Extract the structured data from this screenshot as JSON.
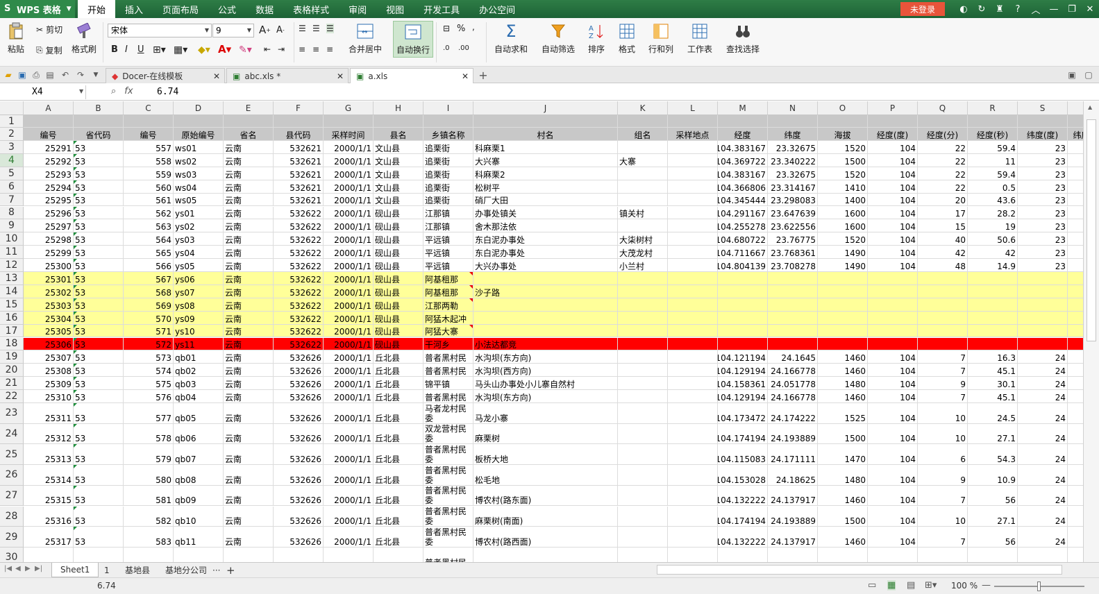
{
  "app": {
    "name": "WPS 表格",
    "login_label": "未登录",
    "help_label": "?"
  },
  "menu_tabs": [
    "开始",
    "插入",
    "页面布局",
    "公式",
    "数据",
    "表格样式",
    "审阅",
    "视图",
    "开发工具",
    "办公空间"
  ],
  "ribbon": {
    "paste": "粘贴",
    "cut": "剪切",
    "copy": "复制",
    "format_painter": "格式刷",
    "font_name": "宋体",
    "font_size": "9",
    "bold": "B",
    "italic": "I",
    "underline": "U",
    "merge_center": "合并居中",
    "wrap_text": "自动换行",
    "percent": "%",
    "autosum": "自动求和",
    "autofilter": "自动筛选",
    "sort": "排序",
    "format": "格式",
    "row_col": "行和列",
    "worksheet": "工作表",
    "find_select": "查找选择"
  },
  "doc_tabs": [
    {
      "label": "Docer-在线模板"
    },
    {
      "label": "abc.xls *"
    },
    {
      "label": "a.xls"
    }
  ],
  "formula_bar": {
    "cell_ref": "X4",
    "fx": "fx",
    "value": "6.74"
  },
  "columns": [
    "A",
    "B",
    "C",
    "D",
    "E",
    "F",
    "G",
    "H",
    "I",
    "J",
    "K",
    "L",
    "M",
    "N",
    "O",
    "P",
    "Q",
    "R",
    "S"
  ],
  "header_row": [
    "编号",
    "省代码",
    "编号",
    "原始编号",
    "省名",
    "县代码",
    "采样时间",
    "县名",
    "乡镇名称",
    "村名",
    "组名",
    "采样地点",
    "经度",
    "纬度",
    "海拔",
    "经度(度)",
    "经度(分)",
    "经度(秒)",
    "纬度(度)",
    "纬度"
  ],
  "rows": [
    {
      "n": "3",
      "cells": [
        "25291",
        "53",
        "557",
        "ws01",
        "云南",
        "532621",
        "2000/1/1",
        "文山县",
        "追栗街",
        "科麻栗1",
        "",
        "",
        "104.383167",
        "23.32675",
        "1520",
        "104",
        "22",
        "59.4",
        "23"
      ]
    },
    {
      "n": "4",
      "cells": [
        "25292",
        "53",
        "558",
        "ws02",
        "云南",
        "532621",
        "2000/1/1",
        "文山县",
        "追栗街",
        "大兴寨",
        "大寨",
        "",
        "104.369722",
        "23.340222",
        "1500",
        "104",
        "22",
        "11",
        "23"
      ]
    },
    {
      "n": "5",
      "cells": [
        "25293",
        "53",
        "559",
        "ws03",
        "云南",
        "532621",
        "2000/1/1",
        "文山县",
        "追栗街",
        "科麻栗2",
        "",
        "",
        "104.383167",
        "23.32675",
        "1520",
        "104",
        "22",
        "59.4",
        "23"
      ]
    },
    {
      "n": "6",
      "cells": [
        "25294",
        "53",
        "560",
        "ws04",
        "云南",
        "532621",
        "2000/1/1",
        "文山县",
        "追栗街",
        "松树平",
        "",
        "",
        "104.366806",
        "23.314167",
        "1410",
        "104",
        "22",
        "0.5",
        "23"
      ]
    },
    {
      "n": "7",
      "cells": [
        "25295",
        "53",
        "561",
        "ws05",
        "云南",
        "532621",
        "2000/1/1",
        "文山县",
        "追栗街",
        "硝厂大田",
        "",
        "",
        "104.345444",
        "23.298083",
        "1400",
        "104",
        "20",
        "43.6",
        "23"
      ]
    },
    {
      "n": "8",
      "cells": [
        "25296",
        "53",
        "562",
        "ys01",
        "云南",
        "532622",
        "2000/1/1",
        "砚山县",
        "江那镇",
        "办事处镇关",
        "镇关村",
        "",
        "104.291167",
        "23.647639",
        "1600",
        "104",
        "17",
        "28.2",
        "23"
      ]
    },
    {
      "n": "9",
      "cells": [
        "25297",
        "53",
        "563",
        "ys02",
        "云南",
        "532622",
        "2000/1/1",
        "砚山县",
        "江那镇",
        "舍木那法依",
        "",
        "",
        "104.255278",
        "23.622556",
        "1600",
        "104",
        "15",
        "19",
        "23"
      ]
    },
    {
      "n": "10",
      "cells": [
        "25298",
        "53",
        "564",
        "ys03",
        "云南",
        "532622",
        "2000/1/1",
        "砚山县",
        "平远镇",
        "东白泥办事处",
        "大柒树村",
        "",
        "104.680722",
        "23.76775",
        "1520",
        "104",
        "40",
        "50.6",
        "23"
      ]
    },
    {
      "n": "11",
      "cells": [
        "25299",
        "53",
        "565",
        "ys04",
        "云南",
        "532622",
        "2000/1/1",
        "砚山县",
        "平远镇",
        "东白泥办事处",
        "大茂龙村",
        "",
        "104.711667",
        "23.768361",
        "1490",
        "104",
        "42",
        "42",
        "23"
      ]
    },
    {
      "n": "12",
      "cells": [
        "25300",
        "53",
        "566",
        "ys05",
        "云南",
        "532622",
        "2000/1/1",
        "砚山县",
        "平远镇",
        "大兴办事处",
        "小兰村",
        "",
        "104.804139",
        "23.708278",
        "1490",
        "104",
        "48",
        "14.9",
        "23"
      ]
    },
    {
      "n": "13",
      "cells": [
        "25301",
        "53",
        "567",
        "ys06",
        "云南",
        "532622",
        "2000/1/1",
        "砚山县",
        "阿基租那",
        "",
        "",
        "",
        "",
        "",
        "",
        "",
        "",
        "",
        ""
      ]
    },
    {
      "n": "14",
      "cells": [
        "25302",
        "53",
        "568",
        "ys07",
        "云南",
        "532622",
        "2000/1/1",
        "砚山县",
        "阿基租那",
        "沙子路",
        "",
        "",
        "",
        "",
        "",
        "",
        "",
        "",
        ""
      ]
    },
    {
      "n": "15",
      "cells": [
        "25303",
        "53",
        "569",
        "ys08",
        "云南",
        "532622",
        "2000/1/1",
        "砚山县",
        "江那两勒",
        "",
        "",
        "",
        "",
        "",
        "",
        "",
        "",
        "",
        ""
      ]
    },
    {
      "n": "16",
      "cells": [
        "25304",
        "53",
        "570",
        "ys09",
        "云南",
        "532622",
        "2000/1/1",
        "砚山县",
        "阿猛木起冲",
        "",
        "",
        "",
        "",
        "",
        "",
        "",
        "",
        "",
        ""
      ]
    },
    {
      "n": "17",
      "cells": [
        "25305",
        "53",
        "571",
        "ys10",
        "云南",
        "532622",
        "2000/1/1",
        "砚山县",
        "阿猛大寨",
        "",
        "",
        "",
        "",
        "",
        "",
        "",
        "",
        "",
        ""
      ]
    },
    {
      "n": "18",
      "cells": [
        "25306",
        "53",
        "572",
        "ys11",
        "云南",
        "532622",
        "2000/1/1",
        "砚山县",
        "干河乡",
        "小法达都竞",
        "",
        "",
        "",
        "",
        "",
        "",
        "",
        "",
        ""
      ]
    },
    {
      "n": "19",
      "cells": [
        "25307",
        "53",
        "573",
        "qb01",
        "云南",
        "532626",
        "2000/1/1",
        "丘北县",
        "普者黑村民",
        "水沟坝(东方向)",
        "",
        "",
        "104.121194",
        "24.1645",
        "1460",
        "104",
        "7",
        "16.3",
        "24"
      ]
    },
    {
      "n": "20",
      "cells": [
        "25308",
        "53",
        "574",
        "qb02",
        "云南",
        "532626",
        "2000/1/1",
        "丘北县",
        "普者黑村民",
        "水沟坝(西方向)",
        "",
        "",
        "104.129194",
        "24.166778",
        "1460",
        "104",
        "7",
        "45.1",
        "24"
      ]
    },
    {
      "n": "21",
      "cells": [
        "25309",
        "53",
        "575",
        "qb03",
        "云南",
        "532626",
        "2000/1/1",
        "丘北县",
        "锦平镇",
        "马头山办事处小儿寨自然村",
        "",
        "",
        "104.158361",
        "24.051778",
        "1480",
        "104",
        "9",
        "30.1",
        "24"
      ]
    },
    {
      "n": "22",
      "cells": [
        "25310",
        "53",
        "576",
        "qb04",
        "云南",
        "532626",
        "2000/1/1",
        "丘北县",
        "普者黑村民",
        "水沟坝(东方向)",
        "",
        "",
        "104.129194",
        "24.166778",
        "1460",
        "104",
        "7",
        "45.1",
        "24"
      ]
    },
    {
      "n": "23",
      "cells": [
        "25311",
        "53",
        "577",
        "qb05",
        "云南",
        "532626",
        "2000/1/1",
        "丘北县",
        "马者龙村民委",
        "马龙小寨",
        "",
        "",
        "104.173472",
        "24.174222",
        "1525",
        "104",
        "10",
        "24.5",
        "24"
      ]
    },
    {
      "n": "24",
      "cells": [
        "25312",
        "53",
        "578",
        "qb06",
        "云南",
        "532626",
        "2000/1/1",
        "丘北县",
        "双龙营村民委",
        "麻栗树",
        "",
        "",
        "104.174194",
        "24.193889",
        "1500",
        "104",
        "10",
        "27.1",
        "24"
      ]
    },
    {
      "n": "25",
      "cells": [
        "25313",
        "53",
        "579",
        "qb07",
        "云南",
        "532626",
        "2000/1/1",
        "丘北县",
        "普者黑村民委",
        "板桥大地",
        "",
        "",
        "104.115083",
        "24.171111",
        "1470",
        "104",
        "6",
        "54.3",
        "24"
      ]
    },
    {
      "n": "26",
      "cells": [
        "25314",
        "53",
        "580",
        "qb08",
        "云南",
        "532626",
        "2000/1/1",
        "丘北县",
        "普者黑村民委",
        "松毛地",
        "",
        "",
        "104.153028",
        "24.18625",
        "1480",
        "104",
        "9",
        "10.9",
        "24"
      ]
    },
    {
      "n": "27",
      "cells": [
        "25315",
        "53",
        "581",
        "qb09",
        "云南",
        "532626",
        "2000/1/1",
        "丘北县",
        "普者黑村民委",
        "博农村(路东面)",
        "",
        "",
        "104.132222",
        "24.137917",
        "1460",
        "104",
        "7",
        "56",
        "24"
      ]
    },
    {
      "n": "28",
      "cells": [
        "25316",
        "53",
        "582",
        "qb10",
        "云南",
        "532626",
        "2000/1/1",
        "丘北县",
        "普者黑村民委",
        "麻栗树(南面)",
        "",
        "",
        "104.174194",
        "24.193889",
        "1500",
        "104",
        "10",
        "27.1",
        "24"
      ]
    },
    {
      "n": "29",
      "cells": [
        "25317",
        "53",
        "583",
        "qb11",
        "云南",
        "532626",
        "2000/1/1",
        "丘北县",
        "普者黑村民委",
        "博农村(路西面)",
        "",
        "",
        "104.132222",
        "24.137917",
        "1460",
        "104",
        "7",
        "56",
        "24"
      ]
    },
    {
      "n": "30",
      "cells": [
        "",
        "",
        "",
        "",
        "",
        "",
        "",
        "",
        "普者黑村民",
        "",
        "",
        "",
        "",
        "",
        "",
        "",
        "",
        "",
        ""
      ]
    }
  ],
  "sheet_tabs": [
    "Sheet1",
    "1",
    "基地县",
    "基地分公司"
  ],
  "sheet_more": "···",
  "sheet_add": "+",
  "status": {
    "value": "6.74",
    "zoom": "100 %"
  },
  "colors": {
    "menu_green": "#1f6b3a",
    "highlight_yellow": "#ffff99",
    "highlight_red": "#ff0000",
    "header_grey": "#c8c8c8"
  }
}
